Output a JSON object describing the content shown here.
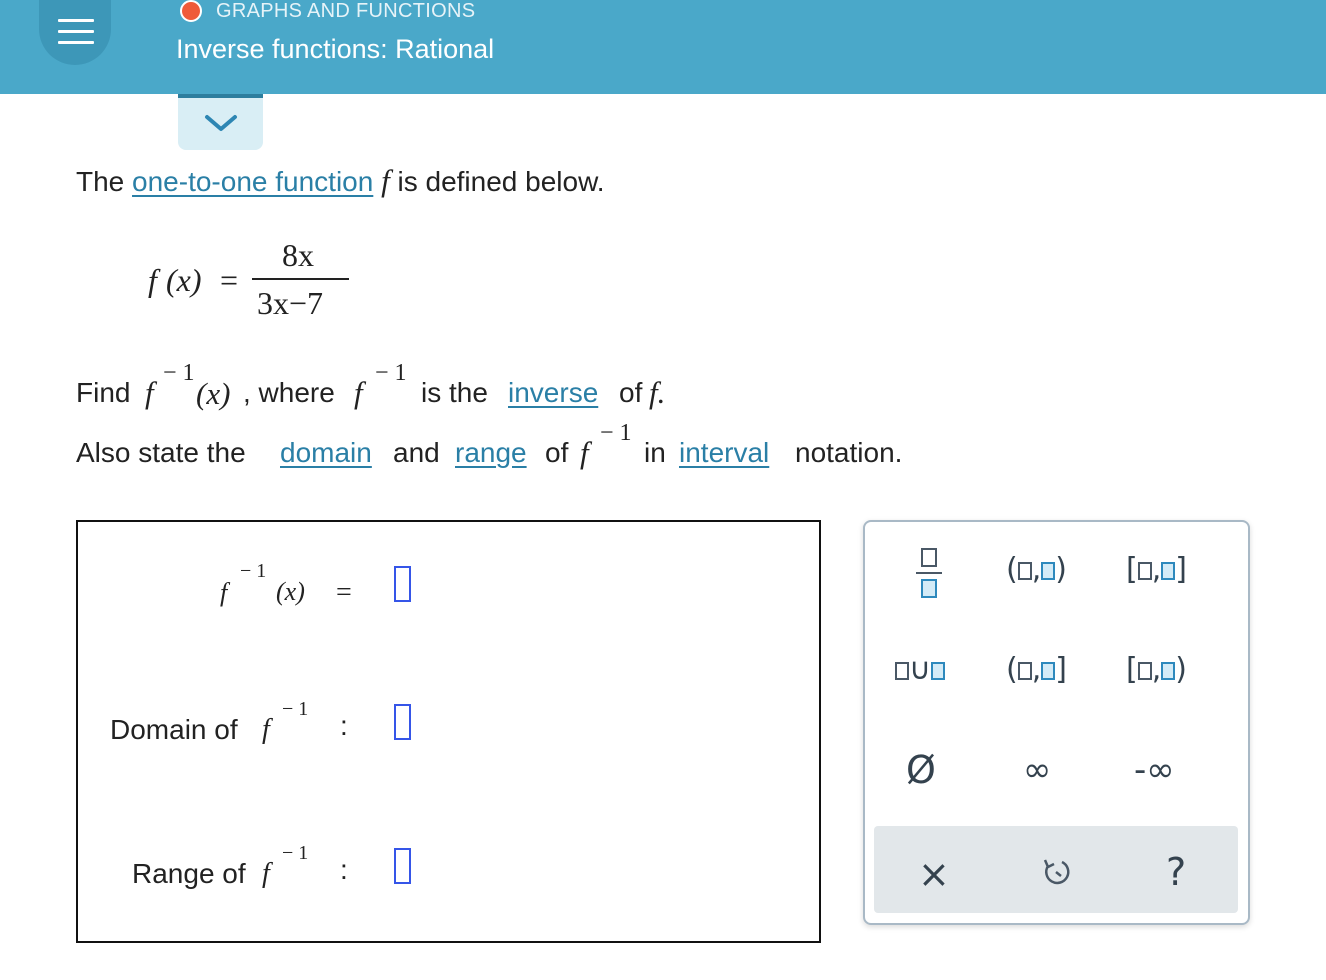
{
  "header": {
    "topic": "GRAPHS AND FUNCTIONS",
    "lesson_title": "Inverse functions: Rational",
    "menu_icon": "hamburger-menu-icon",
    "collapse_icon": "chevron-down-icon",
    "colors": {
      "bar": "#4aa8c9",
      "status_dot": "#ef5b3a"
    }
  },
  "problem": {
    "intro_prefix": "The",
    "intro_link": "one-to-one function",
    "intro_f": "f",
    "intro_suffix": "is defined below.",
    "definition": {
      "lhs": "f",
      "arg": "(x)",
      "eq": "=",
      "numerator": "8x",
      "denominator": "3x−7"
    },
    "find": {
      "word": "Find",
      "f": "f",
      "sup": "− 1",
      "arg": "(x)",
      "comma_where": ", where",
      "is_the": "is the",
      "link_inverse": "inverse",
      "of": "of",
      "end_f": "f."
    },
    "also": {
      "text1": "Also state the",
      "link_domain": "domain",
      "and": "and",
      "link_range": "range",
      "of": "of",
      "f": "f",
      "sup": "− 1",
      "in": "in",
      "link_interval": "interval",
      "notation": "notation."
    }
  },
  "answer": {
    "row1": {
      "f": "f",
      "sup": "− 1",
      "arg": "(x)",
      "sep": "="
    },
    "row2": {
      "label": "Domain of",
      "f": "f",
      "sup": "− 1",
      "sep": ":"
    },
    "row3": {
      "label": "Range of",
      "f": "f",
      "sup": "− 1",
      "sep": ":"
    },
    "input_color": "#3555e8"
  },
  "keypad": {
    "keys": [
      {
        "name": "fraction-button",
        "label": ""
      },
      {
        "name": "open-open-interval-button",
        "label": "(□,□)"
      },
      {
        "name": "closed-closed-interval-button",
        "label": "[□,□]"
      },
      {
        "name": "union-button",
        "label": "□∪□"
      },
      {
        "name": "open-closed-interval-button",
        "label": "(□,□]"
      },
      {
        "name": "closed-open-interval-button",
        "label": "[□,□)"
      },
      {
        "name": "empty-set-button",
        "label": "Ø"
      },
      {
        "name": "infinity-button",
        "label": "∞"
      },
      {
        "name": "negative-infinity-button",
        "label": "-∞"
      }
    ],
    "toolbar": {
      "clear_icon": "close-icon",
      "undo_icon": "undo-icon",
      "help_icon": "help-icon",
      "clear": "×",
      "help": "?"
    }
  }
}
